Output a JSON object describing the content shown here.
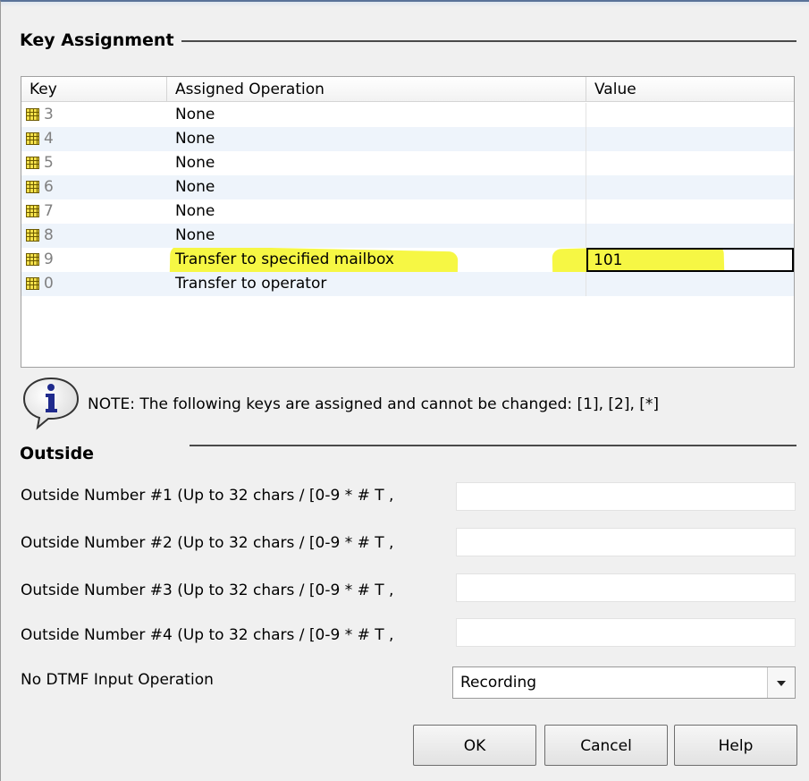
{
  "key_assignment": {
    "title": "Key Assignment",
    "columns": {
      "key": "Key",
      "operation": "Assigned Operation",
      "value": "Value"
    },
    "rows": [
      {
        "key": "3",
        "operation": "None",
        "value": ""
      },
      {
        "key": "4",
        "operation": "None",
        "value": ""
      },
      {
        "key": "5",
        "operation": "None",
        "value": ""
      },
      {
        "key": "6",
        "operation": "None",
        "value": ""
      },
      {
        "key": "7",
        "operation": "None",
        "value": ""
      },
      {
        "key": "8",
        "operation": "None",
        "value": ""
      },
      {
        "key": "9",
        "operation": "Transfer to specified mailbox",
        "value": "101"
      },
      {
        "key": "0",
        "operation": "Transfer to operator",
        "value": ""
      }
    ],
    "highlight_color": "#f6f73a"
  },
  "note": {
    "icon": "info-icon",
    "text": "NOTE: The following keys are assigned and cannot be changed: [1], [2], [*]"
  },
  "outside": {
    "title": "Outside",
    "fields": [
      {
        "label": "Outside Number #1 (Up to 32 chars / [0-9 * # T ,",
        "value": ""
      },
      {
        "label": "Outside Number #2 (Up to 32 chars / [0-9 * # T ,",
        "value": ""
      },
      {
        "label": "Outside Number #3 (Up to 32 chars / [0-9 * # T ,",
        "value": ""
      },
      {
        "label": "Outside Number #4 (Up to 32 chars / [0-9 * # T ,",
        "value": ""
      }
    ],
    "no_dtmf_label": "No DTMF Input Operation",
    "no_dtmf_value": "Recording"
  },
  "buttons": {
    "ok": "OK",
    "cancel": "Cancel",
    "help": "Help"
  }
}
